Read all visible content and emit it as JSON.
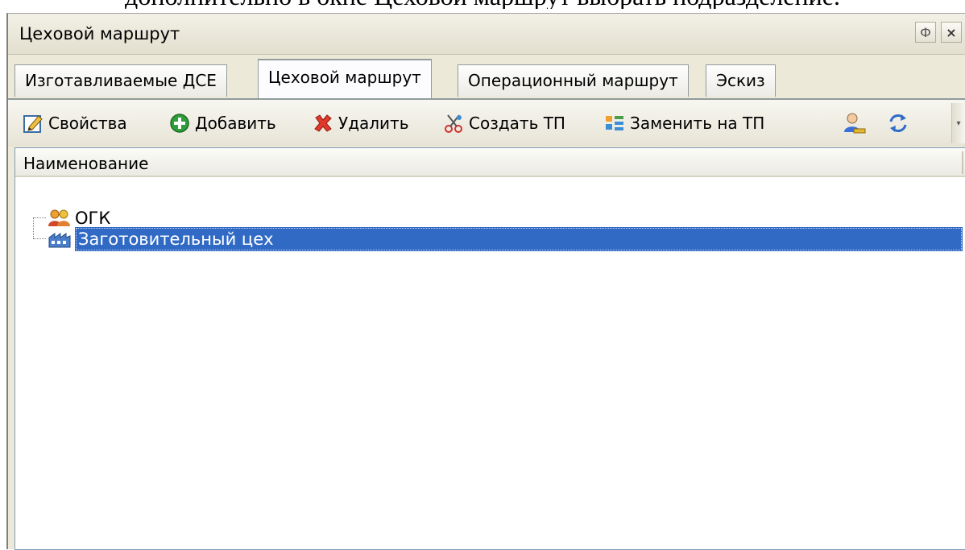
{
  "page_caption": "дополнительно в окне Цеховой маршрут выбрать подразделение.",
  "window": {
    "title": "Цеховой маршрут",
    "pin_glyph": "Ф",
    "close_glyph": "×"
  },
  "tabs": [
    {
      "label": "Изготавливаемые ДСЕ",
      "active": false
    },
    {
      "label": "Цеховой маршрут",
      "active": true
    },
    {
      "label": "Операционный маршрут",
      "active": false
    },
    {
      "label": "Эскиз",
      "active": false
    }
  ],
  "toolbar": {
    "properties": {
      "label": "Свойства",
      "icon": "properties-pencil-icon"
    },
    "add": {
      "label": "Добавить",
      "icon": "add-green-plus-icon"
    },
    "delete": {
      "label": "Удалить",
      "icon": "delete-red-x-icon"
    },
    "create_tp": {
      "label": "Создать ТП",
      "icon": "create-scissors-icon"
    },
    "replace_tp": {
      "label": "Заменить на ТП",
      "icon": "replace-blocks-icon"
    },
    "find_icon": "find-user-icon",
    "refresh_icon": "refresh-arrows-icon",
    "overflow_glyph": "▾"
  },
  "table": {
    "column_header": "Наименование",
    "rows": [
      {
        "label": "ОГК",
        "icon": "group-users-icon",
        "selected": false
      },
      {
        "label": "Заготовительный цех",
        "icon": "workshop-factory-icon",
        "selected": true
      }
    ]
  },
  "colors": {
    "selection": "#316ac5",
    "panel_bg": "#ece9d8",
    "tree_bg": "#ffffff"
  }
}
